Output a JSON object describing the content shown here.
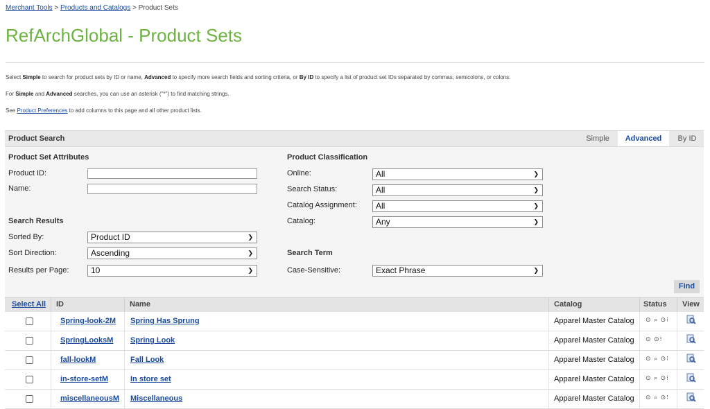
{
  "breadcrumb": {
    "crumb1": "Merchant Tools",
    "sep1": " > ",
    "crumb2": "Products and Catalogs",
    "sep2": " > ",
    "current": "Product Sets"
  },
  "page_title": "RefArchGlobal - Product Sets",
  "info": {
    "line1": {
      "t1": "Select ",
      "b1": "Simple",
      "t2": " to search for product sets by ID or name, ",
      "b2": "Advanced",
      "t3": " to specify more search fields and sorting criteria, or ",
      "b3": "By ID",
      "t4": " to specify a list of product set IDs separated by commas, semicolons, or colons."
    },
    "line2": {
      "t1": "For ",
      "b1": "Simple",
      "t2": " and ",
      "b2": "Advanced",
      "t3": " searches, you can use an asterisk (\"*\") to find matching strings."
    },
    "line3": {
      "t1": "See ",
      "link": "Product Preferences",
      "t2": " to add columns to this page and all other product lists."
    }
  },
  "search": {
    "title": "Product Search",
    "tabs": {
      "simple": "Simple",
      "advanced": "Advanced",
      "by_id": "By ID"
    },
    "attributes": {
      "heading": "Product Set Attributes",
      "product_id_label": "Product ID:",
      "product_id_value": "",
      "name_label": "Name:",
      "name_value": ""
    },
    "results": {
      "heading": "Search Results",
      "sorted_by_label": "Sorted By:",
      "sorted_by_value": "Product ID",
      "sort_direction_label": "Sort Direction:",
      "sort_direction_value": "Ascending",
      "per_page_label": "Results per Page:",
      "per_page_value": "10"
    },
    "classification": {
      "heading": "Product Classification",
      "online_label": "Online:",
      "online_value": "All",
      "search_status_label": "Search Status:",
      "search_status_value": "All",
      "catalog_assignment_label": "Catalog Assignment:",
      "catalog_assignment_value": "All",
      "catalog_label": "Catalog:",
      "catalog_value": "Any"
    },
    "term": {
      "heading": "Search Term",
      "case_label": "Case-Sensitive:",
      "case_value": "Exact Phrase"
    },
    "find_label": "Find"
  },
  "table": {
    "columns": {
      "select_all": "Select All",
      "id": "ID",
      "name": "Name",
      "catalog": "Catalog",
      "status": "Status",
      "view": "View"
    },
    "rows": [
      {
        "id": "Spring-look-2M",
        "name": "Spring Has Sprung",
        "catalog": "Apparel Master Catalog",
        "status": "⊙ ⌕ ⊙⁝"
      },
      {
        "id": "SpringLooksM",
        "name": "Spring Look",
        "catalog": "Apparel Master Catalog",
        "status": "⊙ ⊙⁝"
      },
      {
        "id": "fall-lookM",
        "name": "Fall Look",
        "catalog": "Apparel Master Catalog",
        "status": "⊙ ⌕ ⊙⁝"
      },
      {
        "id": "in-store-setM",
        "name": "In store set",
        "catalog": "Apparel Master Catalog",
        "status": "⊙ ⌕ ⊙⁝"
      },
      {
        "id": "miscellaneousM",
        "name": "Miscellaneous",
        "catalog": "Apparel Master Catalog",
        "status": "⊙ ⌕ ⊙⁝"
      }
    ]
  },
  "colors": {
    "title_green": "#6cb33f",
    "link_blue": "#1a4a9c"
  },
  "icons": {
    "status": [
      "online-icon",
      "searchable-icon",
      "variation-icon"
    ],
    "view": "view-details-icon"
  }
}
